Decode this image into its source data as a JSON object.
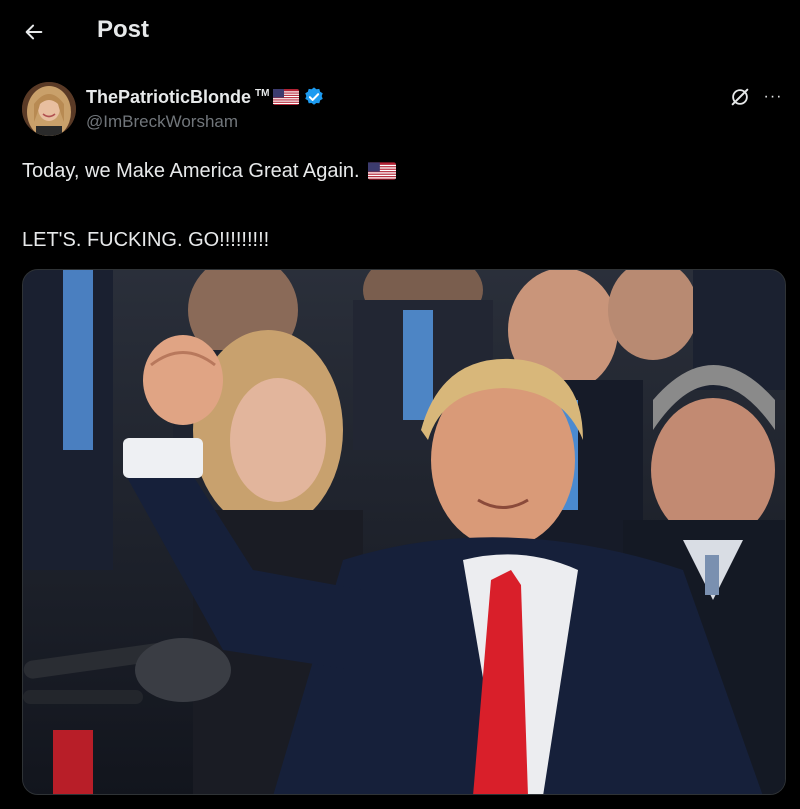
{
  "header": {
    "title": "Post",
    "back_icon": "arrow-left-icon"
  },
  "post": {
    "author": {
      "display_name": "ThePatrioticBlonde",
      "trademark": "TM",
      "handle": "@ImBreckWorsham",
      "verified": true,
      "flag_icon": "us-flag-icon",
      "verified_icon": "verified-badge-icon"
    },
    "text_line1": "Today, we Make America Great Again.",
    "text_line2": "LET'S. FUCKING. GO!!!!!!!!!",
    "actions": {
      "grok_icon": "grok-icon",
      "more_label": "···"
    }
  },
  "colors": {
    "background": "#000000",
    "text_primary": "#e7e9ea",
    "text_secondary": "#71767b",
    "verified_blue": "#1d9bf0",
    "tie_red": "#d91f2a"
  }
}
